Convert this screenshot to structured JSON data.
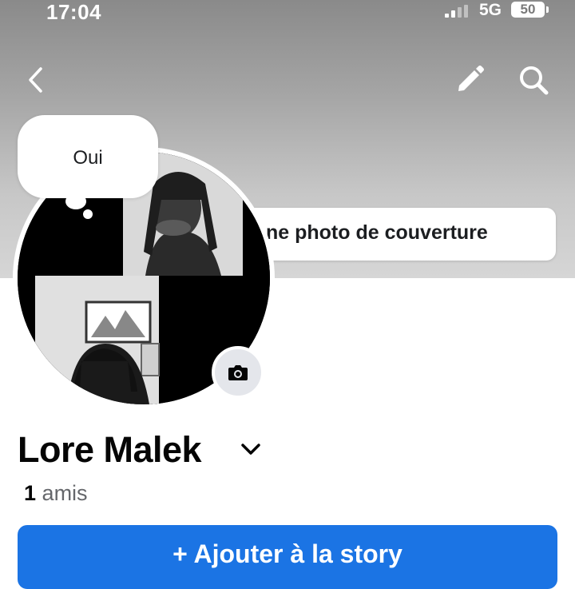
{
  "status_bar": {
    "time": "17:04",
    "network": "5G",
    "battery": "50"
  },
  "header": {
    "back_icon": "chevron-left-icon",
    "edit_icon": "pencil-icon",
    "search_icon": "search-icon"
  },
  "cover": {
    "add_cover_label": "ne photo de couverture"
  },
  "profile": {
    "thought_bubble_text": "Oui",
    "name": "Lore Malek",
    "friends_count": "1",
    "friends_label": "amis",
    "camera_icon": "camera-icon"
  },
  "actions": {
    "add_story_icon": "plus-icon",
    "add_story_label": "+ Ajouter à la story"
  },
  "colors": {
    "accent": "#1b74e4",
    "text_primary": "#050505",
    "text_secondary": "#65676b"
  }
}
